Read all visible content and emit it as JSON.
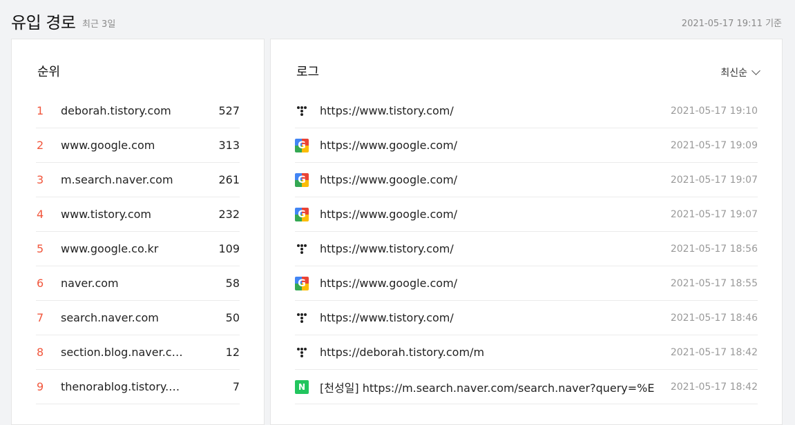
{
  "header": {
    "title": "유입 경로",
    "subtitle": "최근 3일",
    "timestamp": "2021-05-17 19:11 기준"
  },
  "rank_panel": {
    "title": "순위",
    "rows": [
      {
        "rank": "1",
        "domain": "deborah.tistory.com",
        "count": "527"
      },
      {
        "rank": "2",
        "domain": "www.google.com",
        "count": "313"
      },
      {
        "rank": "3",
        "domain": "m.search.naver.com",
        "count": "261"
      },
      {
        "rank": "4",
        "domain": "www.tistory.com",
        "count": "232"
      },
      {
        "rank": "5",
        "domain": "www.google.co.kr",
        "count": "109"
      },
      {
        "rank": "6",
        "domain": "naver.com",
        "count": "58"
      },
      {
        "rank": "7",
        "domain": "search.naver.com",
        "count": "50"
      },
      {
        "rank": "8",
        "domain": "section.blog.naver.c…",
        "count": "12"
      },
      {
        "rank": "9",
        "domain": "thenorablog.tistory.…",
        "count": "7"
      }
    ]
  },
  "log_panel": {
    "title": "로그",
    "sort_label": "최신순",
    "sort_icon": "chevron-down-icon",
    "rows": [
      {
        "icon": "tistory-icon",
        "url": "https://www.tistory.com/",
        "time": "2021-05-17 19:10"
      },
      {
        "icon": "google-icon",
        "url": "https://www.google.com/",
        "time": "2021-05-17 19:09"
      },
      {
        "icon": "google-icon",
        "url": "https://www.google.com/",
        "time": "2021-05-17 19:07"
      },
      {
        "icon": "google-icon",
        "url": "https://www.google.com/",
        "time": "2021-05-17 19:07"
      },
      {
        "icon": "tistory-icon",
        "url": "https://www.tistory.com/",
        "time": "2021-05-17 18:56"
      },
      {
        "icon": "google-icon",
        "url": "https://www.google.com/",
        "time": "2021-05-17 18:55"
      },
      {
        "icon": "tistory-icon",
        "url": "https://www.tistory.com/",
        "time": "2021-05-17 18:46"
      },
      {
        "icon": "tistory-icon",
        "url": "https://deborah.tistory.com/m",
        "time": "2021-05-17 18:42"
      },
      {
        "icon": "naver-icon",
        "url": "[천성일] https://m.search.naver.com/search.naver?query=%EC…",
        "time": "2021-05-17 18:42"
      }
    ]
  },
  "colors": {
    "rank_accent": "#f1563c",
    "background": "#f2f3f5",
    "muted_text": "#999999"
  }
}
